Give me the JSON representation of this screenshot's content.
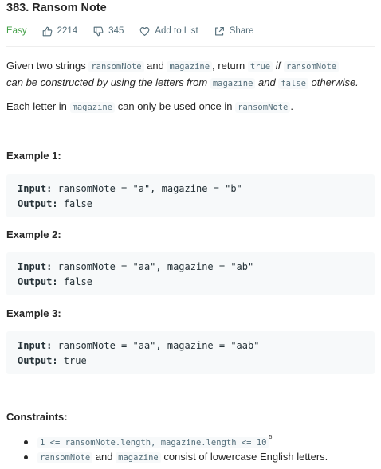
{
  "problem": {
    "title": "383. Ransom Note",
    "difficulty": "Easy",
    "likes": "2214",
    "dislikes": "345",
    "add_to_list": "Add to List",
    "share": "Share"
  },
  "description": {
    "p1": {
      "t1": "Given two strings ",
      "c1": "ransomNote",
      "t2": " and ",
      "c2": "magazine",
      "t3": ", return ",
      "c3": "true",
      "t4": " if ",
      "c4": "ransomNote",
      "t5": "can be constructed by using the letters from ",
      "c5": "magazine",
      "t6": " and ",
      "c6": "false",
      "t7": " otherwise."
    },
    "p2": {
      "t1": "Each letter in ",
      "c1": "magazine",
      "t2": " can only be used once in ",
      "c2": "ransomNote",
      "t3": "."
    }
  },
  "examples": [
    {
      "label": "Example 1:",
      "input_key": "Input:",
      "input": " ransomNote = \"a\", magazine = \"b\"",
      "output_key": "Output:",
      "output": " false"
    },
    {
      "label": "Example 2:",
      "input_key": "Input:",
      "input": " ransomNote = \"aa\", magazine = \"ab\"",
      "output_key": "Output:",
      "output": " false"
    },
    {
      "label": "Example 3:",
      "input_key": "Input:",
      "input": " ransomNote = \"aa\", magazine = \"aab\"",
      "output_key": "Output:",
      "output": " true"
    }
  ],
  "constraints": {
    "heading": "Constraints:",
    "c1_code": "1 <= ransomNote.length, magazine.length <= 10",
    "c1_sup": "5",
    "c2_code1": "ransomNote",
    "c2_t1": " and ",
    "c2_code2": "magazine",
    "c2_t2": " consist of lowercase English letters."
  },
  "icons": [
    "thumbs-up-icon",
    "thumbs-down-icon",
    "heart-icon",
    "share-icon"
  ],
  "colors": {
    "easy": "#43a047",
    "meta": "#546e7a",
    "code_bg": "#f7f9fa"
  }
}
